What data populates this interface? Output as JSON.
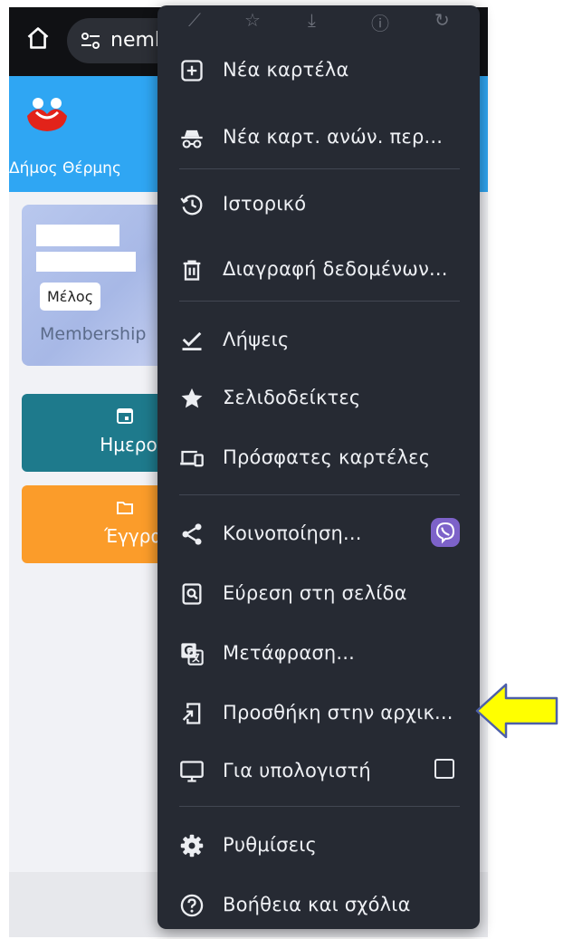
{
  "browser": {
    "url_text": "nemb"
  },
  "site": {
    "municipality_name": "Δήμος Θέρμης",
    "member_badge": "Μέλος",
    "membership_label": "Membership",
    "tiles": [
      {
        "label": "Ημερολό",
        "icon": "calendar-icon",
        "color": "#1e7a8c"
      },
      {
        "label": "Έγγραφ",
        "icon": "folder-icon",
        "color": "#fb9c2a"
      }
    ],
    "header_color": "#2fa6f3"
  },
  "menu": {
    "background": "#262a33",
    "items": [
      {
        "id": "new-tab",
        "label": "Νέα καρτέλα",
        "icon": "plus-box-icon"
      },
      {
        "id": "incognito",
        "label": "Νέα καρτ. ανών. περ...",
        "icon": "incognito-icon"
      },
      {
        "id": "history",
        "label": "Ιστορικό",
        "icon": "history-icon"
      },
      {
        "id": "clear-data",
        "label": "Διαγραφή δεδομένων...",
        "icon": "trash-icon"
      },
      {
        "id": "downloads",
        "label": "Λήψεις",
        "icon": "download-check-icon"
      },
      {
        "id": "bookmarks",
        "label": "Σελιδοδείκτες",
        "icon": "star-icon"
      },
      {
        "id": "recent-tabs",
        "label": "Πρόσφατες καρτέλες",
        "icon": "devices-icon"
      },
      {
        "id": "share",
        "label": "Κοινοποίηση...",
        "icon": "share-icon"
      },
      {
        "id": "find",
        "label": "Εύρεση στη σελίδα",
        "icon": "find-in-page-icon"
      },
      {
        "id": "translate",
        "label": "Μετάφραση...",
        "icon": "translate-icon"
      },
      {
        "id": "add-home",
        "label": "Προσθήκη στην αρχικ...",
        "icon": "add-to-home-icon"
      },
      {
        "id": "desktop",
        "label": "Για υπολογιστή",
        "icon": "monitor-icon"
      },
      {
        "id": "settings",
        "label": "Ρυθμίσεις",
        "icon": "gear-icon"
      },
      {
        "id": "help",
        "label": "Βοήθεια και σχόλια",
        "icon": "help-circle-icon"
      }
    ],
    "desktop_checked": false
  },
  "annotation": {
    "arrow_color": "#ffff00",
    "arrow_points_to": "add-home"
  }
}
